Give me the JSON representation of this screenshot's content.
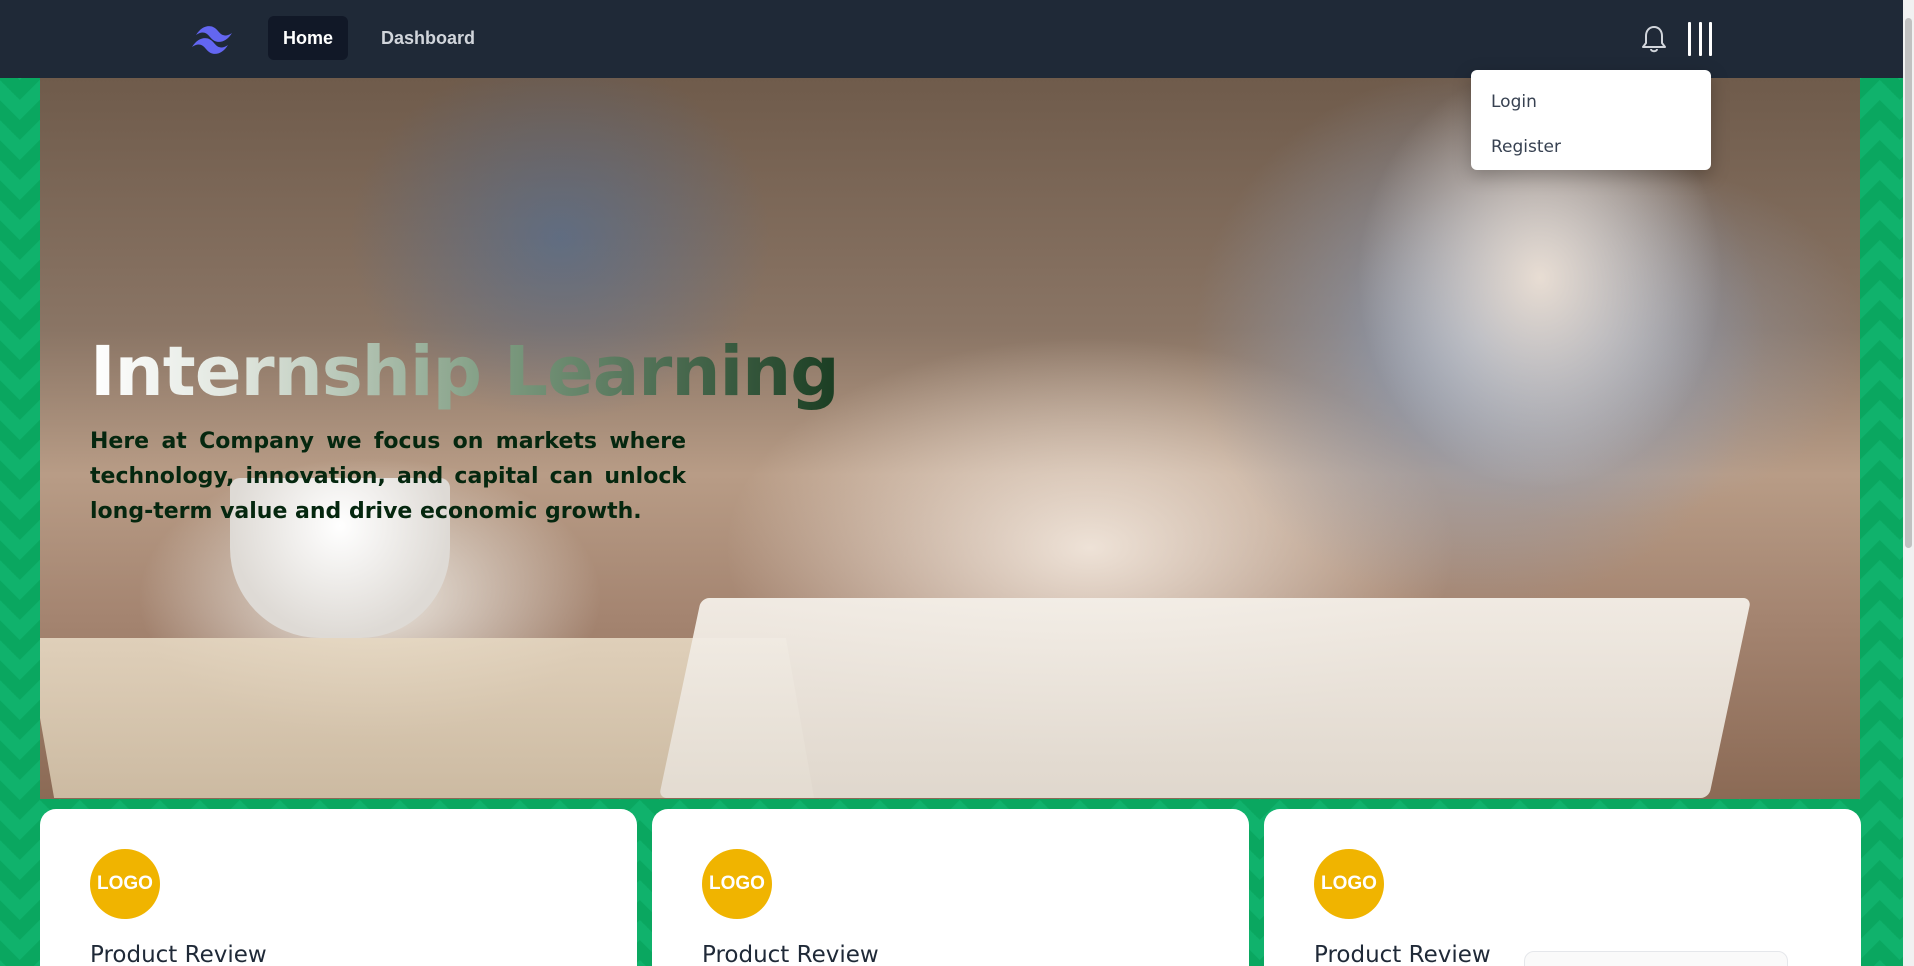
{
  "nav": {
    "logo_icon": "tailwind-wave-logo",
    "logo_color": "#6366f1",
    "items": [
      {
        "label": "Home",
        "active": true
      },
      {
        "label": "Dashboard",
        "active": false
      }
    ],
    "notification_icon": "bell-icon",
    "menu_icon": "menu-bars-icon"
  },
  "dropdown": {
    "items": [
      {
        "label": "Login"
      },
      {
        "label": "Register"
      }
    ]
  },
  "hero": {
    "title": "Internship Learning",
    "description": "Here at Company we focus on markets where technology, innovation, and capital can unlock long-term value and drive economic growth."
  },
  "cards": [
    {
      "logo_text": "LOGO",
      "title": "Product Review"
    },
    {
      "logo_text": "LOGO",
      "title": "Product Review"
    },
    {
      "logo_text": "LOGO",
      "title": "Product Review"
    }
  ],
  "colors": {
    "navbar": "#1f2937",
    "background_green": "#10b26c",
    "logo_badge": "#f0b400"
  }
}
